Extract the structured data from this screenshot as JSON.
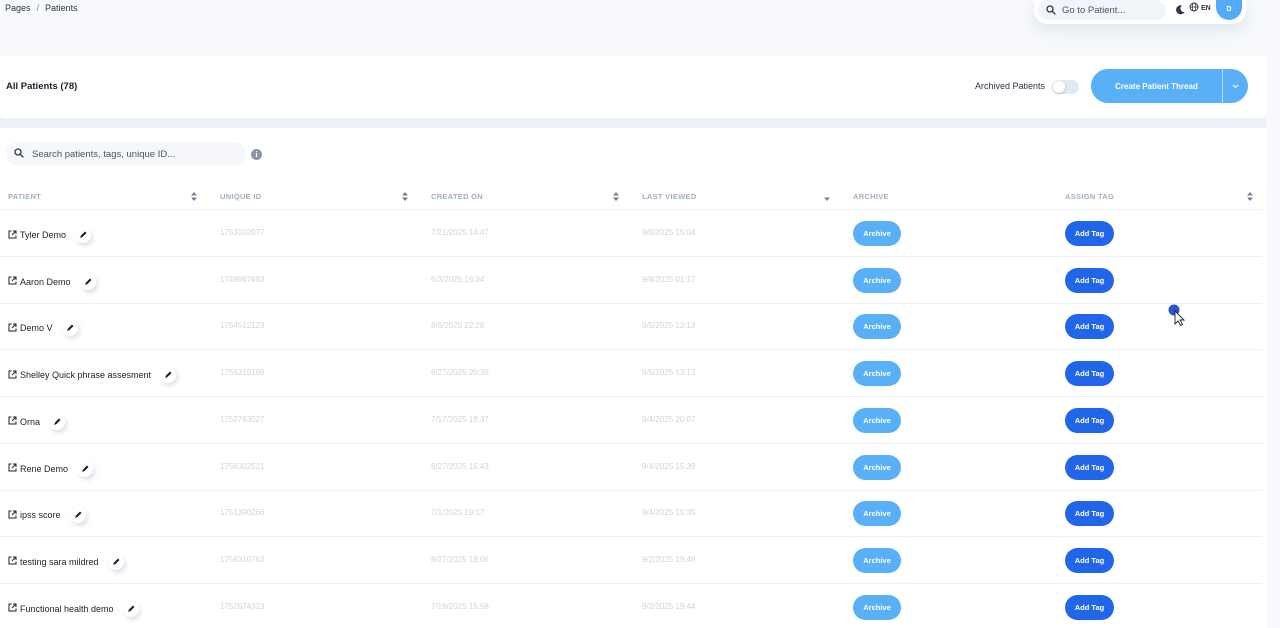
{
  "breadcrumb": {
    "parent": "Pages",
    "separator": "/",
    "current": "Patients"
  },
  "topnav": {
    "goto_placeholder": "Go to Patient...",
    "lang": "EN",
    "avatar_initial": "D"
  },
  "header": {
    "title": "All Patients (78)",
    "archived_label": "Archived Patients",
    "archived_toggle_on": false,
    "create_label": "Create Patient Thread"
  },
  "search": {
    "placeholder": "Search patients, tags, unique ID..."
  },
  "columns": [
    "PATIENT",
    "UNIQUE ID",
    "CREATED ON",
    "LAST VIEWED",
    "ARCHIVE",
    "ASSIGN TAG"
  ],
  "rows": [
    {
      "name": "Tyler Demo",
      "id": "1753102077",
      "created": "7/21/2025 14:47",
      "viewed": "9/8/2025 15:04"
    },
    {
      "name": "Aaron Demo",
      "id": "1748967683",
      "created": "6/3/2025 16:34",
      "viewed": "9/8/2025 01:17"
    },
    {
      "name": "Demo V",
      "id": "1754512123",
      "created": "8/6/2025 22:28",
      "viewed": "9/5/2025 13:13"
    },
    {
      "name": "Shelley Quick phrase assesment",
      "id": "1756319186",
      "created": "8/27/2025 20:36",
      "viewed": "9/5/2025 13:13"
    },
    {
      "name": "Orna",
      "id": "1752783027",
      "created": "7/17/2025 18:37",
      "viewed": "9/4/2025 20:07"
    },
    {
      "name": "Rene Demo",
      "id": "1756302521",
      "created": "8/27/2025 15:43",
      "viewed": "9/4/2025 15:39"
    },
    {
      "name": "ipss score",
      "id": "1751390266",
      "created": "7/1/2025 19:17",
      "viewed": "9/4/2025 15:35"
    },
    {
      "name": "testing sara mildred",
      "id": "1756310763",
      "created": "8/27/2025 18:06",
      "viewed": "9/2/2025 19:48"
    },
    {
      "name": "Functional health demo",
      "id": "1752674323",
      "created": "7/16/2025 15:58",
      "viewed": "9/2/2025 19:44"
    }
  ],
  "actions": {
    "archive_label": "Archive",
    "tag_label": "Add Tag"
  },
  "colors": {
    "primary_light": "#5ab0f7",
    "primary_dark": "#2166e8",
    "cursor": "#2a56c6"
  }
}
